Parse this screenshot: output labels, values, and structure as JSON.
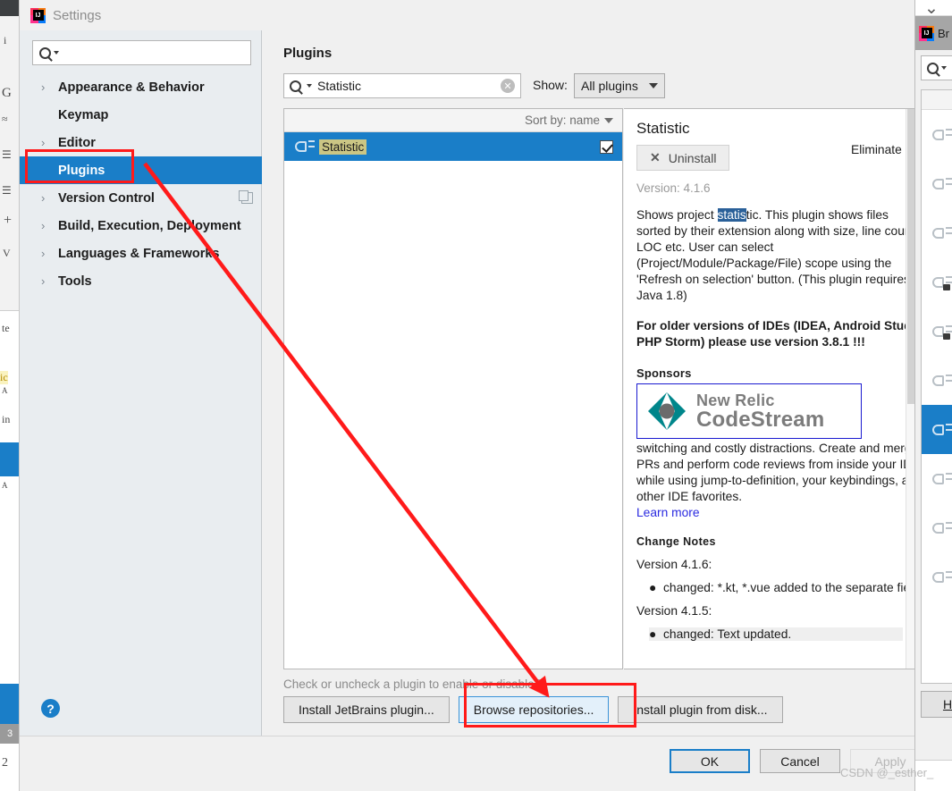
{
  "window": {
    "title": "Settings",
    "app_icon": "intellij-idea-logo-icon"
  },
  "sidebar": {
    "search_placeholder": "",
    "search_value": "",
    "items": [
      {
        "label": "Appearance & Behavior",
        "expandable": true,
        "selected": false
      },
      {
        "label": "Keymap",
        "expandable": false,
        "selected": false
      },
      {
        "label": "Editor",
        "expandable": true,
        "selected": false
      },
      {
        "label": "Plugins",
        "expandable": false,
        "selected": true
      },
      {
        "label": "Version Control",
        "expandable": true,
        "selected": false
      },
      {
        "label": "Build, Execution, Deployment",
        "expandable": true,
        "selected": false
      },
      {
        "label": "Languages & Frameworks",
        "expandable": true,
        "selected": false
      },
      {
        "label": "Tools",
        "expandable": true,
        "selected": false
      }
    ],
    "help_label": "?"
  },
  "main": {
    "panel_title": "Plugins",
    "search_value": "Statistic",
    "show_label": "Show:",
    "show_value": "All plugins",
    "sort_label": "Sort by: name",
    "plugins": [
      {
        "name": "Statistic",
        "enabled": true,
        "selected": true
      }
    ],
    "hint": "Check or uncheck a plugin to enable or disable it.",
    "buttons": [
      {
        "label": "Install JetBrains plugin...",
        "focused": false
      },
      {
        "label": "Browse repositories...",
        "focused": true
      },
      {
        "label": "Install plugin from disk...",
        "focused": false
      }
    ]
  },
  "details": {
    "title": "Statistic",
    "uninstall_label": "Uninstall",
    "version_line": "Version: 4.1.6",
    "description_lines": [
      {
        "pre": "Shows project ",
        "highlight": "statis",
        "post": "tic. This plugin shows files"
      },
      {
        "pre": "sorted by their extension along with size, line count",
        "highlight": "",
        "post": ""
      },
      {
        "pre": "LOC etc. User can select",
        "highlight": "",
        "post": ""
      },
      {
        "pre": "(Project/Module/Package/File) scope using the",
        "highlight": "",
        "post": ""
      },
      {
        "pre": "'Refresh on selection' button. (This plugin requires",
        "highlight": "",
        "post": ""
      },
      {
        "pre": "Java 1.8)",
        "highlight": "",
        "post": ""
      }
    ],
    "bold_lines": [
      "For older versions of IDEs (IDEA, Android Stud",
      "PHP Storm) please use version 3.8.1 !!!"
    ],
    "sponsors_heading": "Sponsors",
    "sponsor": {
      "name_line1": "New Relic",
      "name_line2": "CodeStream",
      "logo": "new-relic-codestream-logo",
      "border_color": "#1a1ad0"
    },
    "sponsor_text_lines": [
      "Eliminate c",
      "switching and costly distractions. Create and merg",
      "PRs and perform code reviews from inside your ID",
      "while using jump-to-definition, your keybindings, an",
      "other IDE favorites."
    ],
    "learn_more_label": "Learn more",
    "change_notes_heading": "Change Notes",
    "change_notes": [
      {
        "version": "Version 4.1.6:",
        "items": [
          "changed: *.kt, *.vue added to the separate fields"
        ]
      },
      {
        "version": "Version 4.1.5:",
        "items": [
          "changed: Text updated."
        ]
      }
    ]
  },
  "footer": {
    "ok_label": "OK",
    "cancel_label": "Cancel",
    "apply_label": "Apply",
    "apply_disabled": true
  },
  "background_window": {
    "title": "Br",
    "help_label": "H"
  },
  "watermark": "CSDN @_esther_",
  "annotations": {
    "accent_red": "#ff1a1a",
    "highlight_rects": [
      "plugins-sidebar-item",
      "browse-repositories-button"
    ],
    "arrow": "red-arrow-from-plugins-to-browse-repositories"
  },
  "colors": {
    "selection_blue": "#1a7ec8",
    "dialog_bg": "#f0f0f0",
    "sidebar_bg": "#e9edf0",
    "search_match_yellow": "#cbc684",
    "link_blue": "#2a2ae0"
  }
}
